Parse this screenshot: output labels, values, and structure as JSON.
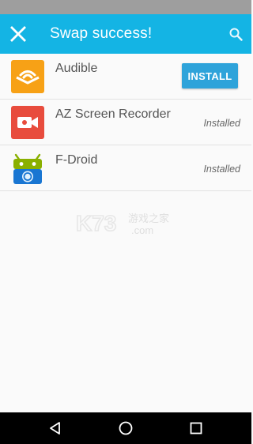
{
  "app_bar": {
    "title": "Swap success!",
    "close_icon": "close-icon",
    "search_icon": "search-icon",
    "color": "#14b4e4"
  },
  "apps": [
    {
      "name": "Audible",
      "action": "INSTALL",
      "icon": "audible-icon",
      "icon_color": "#f7a116"
    },
    {
      "name": "AZ Screen Recorder",
      "status": "Installed",
      "icon": "az-recorder-icon",
      "icon_color": "#e84c3d"
    },
    {
      "name": "F-Droid",
      "status": "Installed",
      "icon": "fdroid-icon",
      "icon_color": "#8ab000"
    }
  ],
  "watermark": {
    "logo": "K73",
    "text": "游戏之家",
    "domain": ".com"
  },
  "nav_bar": {
    "back_icon": "back-triangle-icon",
    "home_icon": "home-circle-icon",
    "recents_icon": "recents-square-icon"
  }
}
